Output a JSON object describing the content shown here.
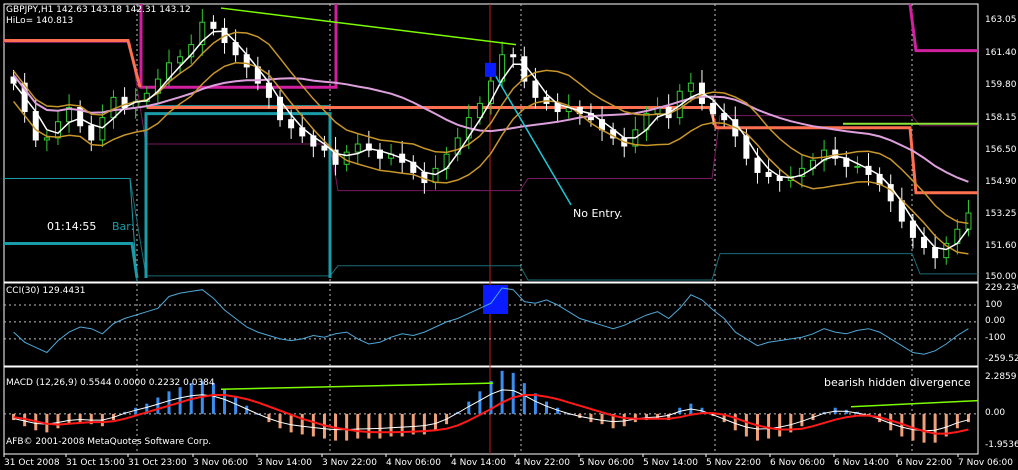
{
  "chart_data": [
    {
      "type": "candlestick",
      "panel": "price",
      "title": "GBPJPY,H1  142.63 143.18 142.31 143.12",
      "indicator_label": "HiLo= 140.813",
      "timer": "01:14:55",
      "bar_label": "Bar:",
      "annotation": "No Entry.",
      "y_ticks": [
        "163.05",
        "161.40",
        "159.80",
        "158.15",
        "156.50",
        "154.90",
        "153.25",
        "151.60",
        "150.00"
      ],
      "ylim": [
        149.8,
        163.5
      ],
      "closes": [
        159.6,
        158.2,
        156.8,
        156.9,
        157.7,
        158.4,
        157.5,
        156.8,
        157.9,
        158.9,
        158.4,
        158.7,
        159.1,
        159.8,
        160.6,
        160.9,
        161.5,
        162.6,
        162.3,
        161.6,
        161.0,
        160.4,
        159.6,
        158.9,
        157.8,
        157.4,
        157.0,
        156.5,
        156.3,
        155.6,
        156.2,
        156.6,
        156.3,
        155.9,
        156.1,
        155.7,
        155.2,
        154.7,
        155.4,
        156.1,
        156.9,
        157.9,
        158.6,
        159.7,
        161.0,
        160.9,
        159.7,
        158.9,
        158.6,
        158.2,
        158.4,
        158.1,
        157.8,
        157.3,
        156.9,
        156.5,
        157.3,
        158.1,
        158.4,
        157.9,
        159.2,
        159.6,
        158.6,
        158.1,
        157.8,
        157.0,
        155.9,
        155.2,
        155.0,
        154.8,
        155.0,
        155.4,
        155.8,
        156.3,
        155.9,
        155.5,
        155.5,
        155.1,
        154.6,
        153.8,
        152.8,
        152.0,
        151.5,
        151.0,
        151.7,
        152.4,
        153.2
      ]
    },
    {
      "type": "line",
      "panel": "cci",
      "title": "CCI(30) 129.4431",
      "y_ticks": [
        "229.2361",
        "100",
        "0.00",
        "-100",
        "-259.5223"
      ],
      "ylim": [
        -259.5223,
        229.2361
      ],
      "series": [
        {
          "values": [
            -60,
            -120,
            -150,
            -180,
            -110,
            -60,
            -30,
            -40,
            -70,
            -10,
            20,
            40,
            60,
            80,
            150,
            170,
            180,
            190,
            140,
            70,
            20,
            -30,
            -60,
            -80,
            -100,
            -110,
            -100,
            -80,
            -90,
            -70,
            -60,
            -100,
            -130,
            -120,
            -90,
            -70,
            -80,
            -60,
            -30,
            0,
            20,
            50,
            80,
            110,
            200,
            190,
            120,
            110,
            130,
            100,
            60,
            20,
            0,
            -20,
            -40,
            -20,
            10,
            40,
            60,
            20,
            80,
            160,
            130,
            70,
            20,
            -60,
            -100,
            -140,
            -120,
            -110,
            -100,
            -90,
            -70,
            -40,
            -60,
            -70,
            -50,
            -40,
            -60,
            -100,
            -140,
            -180,
            -190,
            -170,
            -130,
            -80,
            -40
          ]
        }
      ]
    },
    {
      "type": "bar",
      "panel": "macd",
      "title": "MACD  (12,26,9) 0.5544 0.0000 0.2232 0.0384",
      "annotation": "bearish hidden divergence",
      "copyright": "AFB© 2001-2008 MetaQuotes Software Corp.",
      "y_ticks": [
        "2.2859",
        "0.00",
        "-1.9536"
      ],
      "ylim": [
        -1.9536,
        2.2859
      ],
      "categories": [
        "31 Oct 2008",
        "31 Oct 15:00",
        "31 Oct 23:00",
        "3 Nov 06:00",
        "3 Nov 14:00",
        "3 Nov 22:00",
        "4 Nov 06:00",
        "4 Nov 14:00",
        "4 Nov 22:00",
        "5 Nov 06:00",
        "5 Nov 14:00",
        "5 Nov 22:00",
        "6 Nov 06:00",
        "6 Nov 14:00",
        "6 Nov 22:00",
        "7 Nov 06:00"
      ],
      "values": [
        -0.3,
        -0.6,
        -0.8,
        -0.9,
        -0.7,
        -0.5,
        -0.4,
        -0.5,
        -0.6,
        -0.3,
        0.1,
        0.3,
        0.5,
        0.8,
        1.1,
        1.3,
        1.5,
        1.6,
        1.5,
        1.2,
        0.8,
        0.4,
        0.0,
        -0.4,
        -0.7,
        -0.9,
        -1.0,
        -1.1,
        -1.2,
        -1.3,
        -1.3,
        -1.2,
        -1.2,
        -1.2,
        -1.1,
        -1.1,
        -1.0,
        -1.0,
        -0.8,
        -0.5,
        0.1,
        0.6,
        1.1,
        1.6,
        2.1,
        2.0,
        1.5,
        1.0,
        0.6,
        0.3,
        0.0,
        -0.2,
        -0.4,
        -0.5,
        -0.7,
        -0.6,
        -0.4,
        -0.3,
        -0.2,
        -0.3,
        0.3,
        0.5,
        0.3,
        -0.1,
        -0.4,
        -0.8,
        -1.1,
        -1.3,
        -1.2,
        -1.1,
        -0.9,
        -0.6,
        -0.3,
        0.1,
        0.3,
        0.2,
        0.1,
        -0.1,
        -0.4,
        -0.8,
        -1.1,
        -1.3,
        -1.4,
        -1.4,
        -1.1,
        -0.7,
        -0.4
      ],
      "signal": [
        -0.2,
        -0.3,
        -0.45,
        -0.6,
        -0.65,
        -0.6,
        -0.55,
        -0.5,
        -0.5,
        -0.45,
        -0.3,
        -0.1,
        0.1,
        0.3,
        0.5,
        0.7,
        0.9,
        1.05,
        1.15,
        1.15,
        1.05,
        0.9,
        0.7,
        0.45,
        0.2,
        -0.05,
        -0.3,
        -0.5,
        -0.7,
        -0.85,
        -0.95,
        -1.05,
        -1.1,
        -1.12,
        -1.12,
        -1.1,
        -1.08,
        -1.05,
        -1.0,
        -0.9,
        -0.7,
        -0.4,
        -0.05,
        0.3,
        0.7,
        1.0,
        1.15,
        1.15,
        1.05,
        0.9,
        0.7,
        0.5,
        0.3,
        0.1,
        -0.1,
        -0.25,
        -0.3,
        -0.3,
        -0.3,
        -0.3,
        -0.2,
        -0.05,
        0.05,
        0.05,
        -0.05,
        -0.25,
        -0.5,
        -0.7,
        -0.85,
        -0.95,
        -0.95,
        -0.9,
        -0.75,
        -0.55,
        -0.35,
        -0.2,
        -0.1,
        -0.1,
        -0.2,
        -0.4,
        -0.6,
        -0.85,
        -1.05,
        -1.2,
        -1.2,
        -1.1,
        -0.95
      ]
    }
  ],
  "colors": {
    "bull": "#32cd32",
    "bear": "#ffffff",
    "grid": "#c0c0c0",
    "cci_line": "#4fa8d8",
    "macd_pos": "#3a8ef0",
    "macd_neg": "#f0a078",
    "signal": "#ff1a1a",
    "diverge": "#7cfc00",
    "teal": "#1a9ca8",
    "magenta": "#d020a0",
    "salmon": "#ff7050",
    "gold": "#c8962a",
    "plum": "#dda0dd",
    "signal_box": "#0a1cff"
  }
}
